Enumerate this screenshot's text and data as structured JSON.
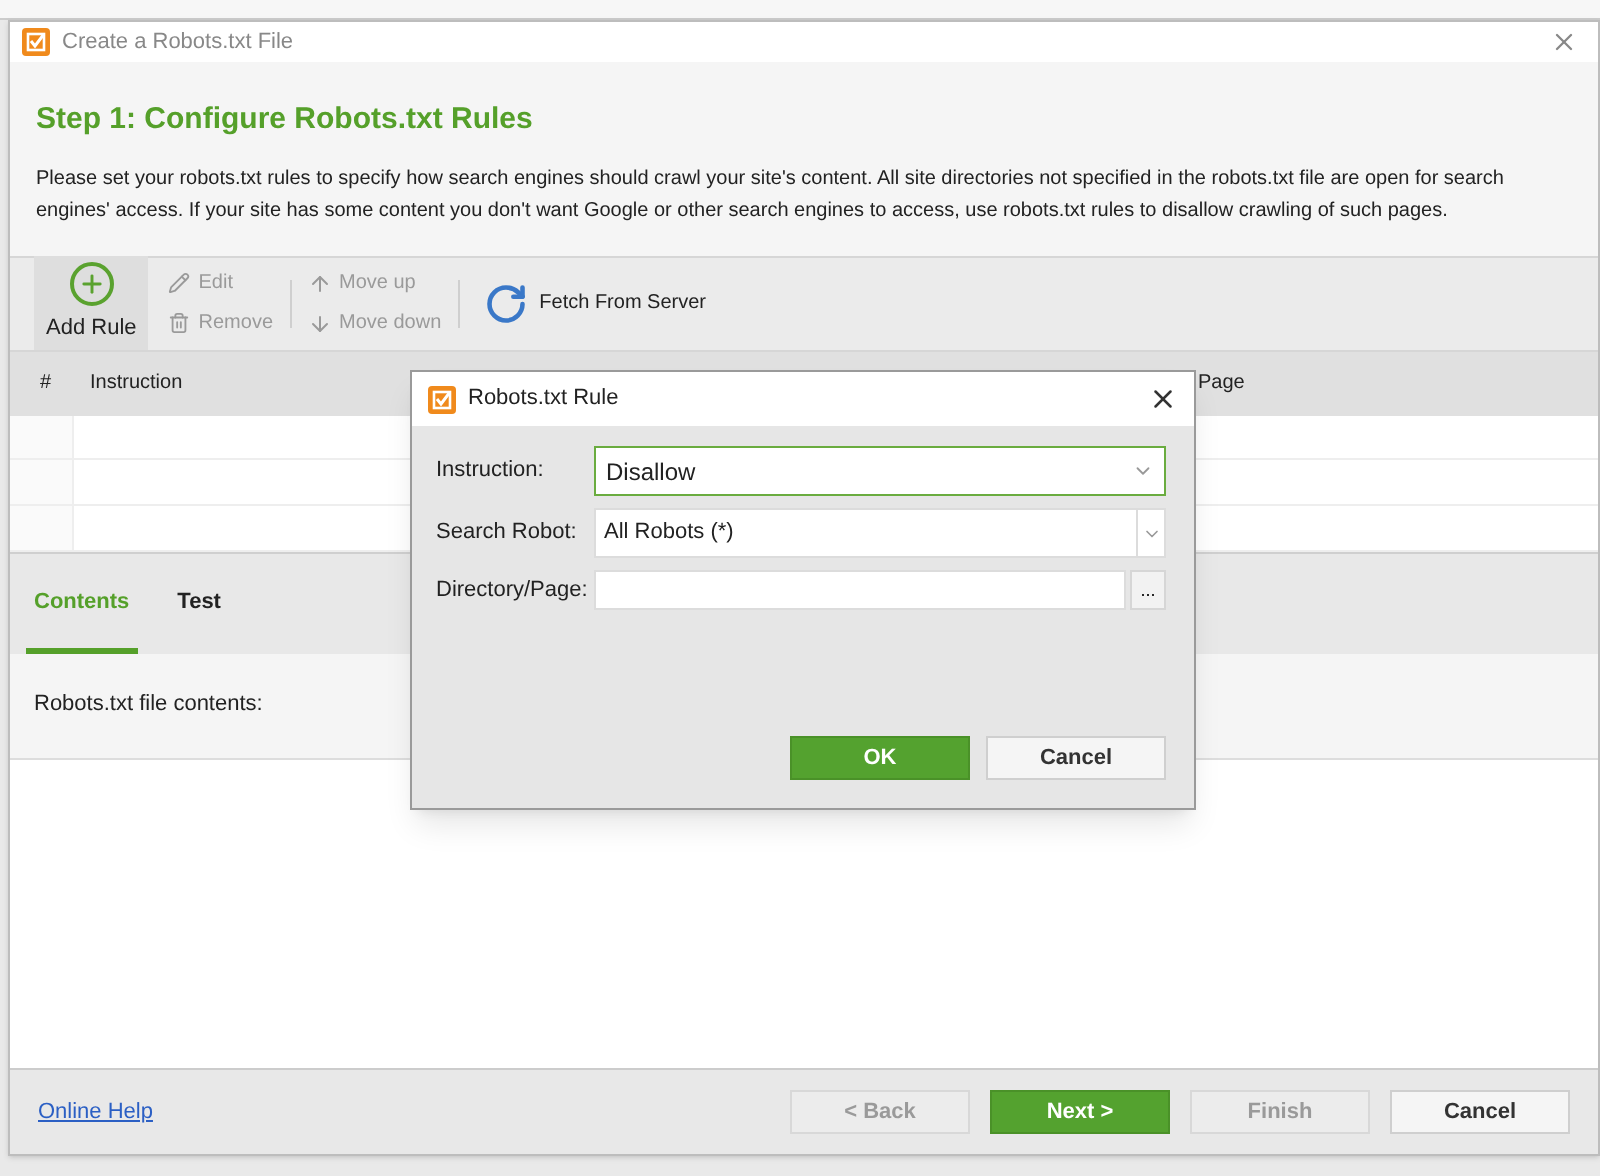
{
  "window": {
    "title": "Create a Robots.txt File"
  },
  "step_title": "Step 1: Configure Robots.txt Rules",
  "description": "Please set your robots.txt rules to specify how search engines should crawl your site's content. All site directories not specified in the robots.txt file are open for search engines' access. If your site has some content you don't want Google or other search engines to access, use robots.txt rules to disallow crawling of such pages.",
  "toolbar": [
    {
      "kind": "big",
      "label": "Add Rule",
      "disabled": false
    },
    {
      "kind": "pair",
      "items": [
        {
          "label": "Edit",
          "disabled": true
        },
        {
          "label": "Remove",
          "disabled": true
        }
      ]
    },
    {
      "kind": "pair",
      "items": [
        {
          "label": "Move up",
          "disabled": true
        },
        {
          "label": "Move down",
          "disabled": true
        }
      ]
    },
    {
      "kind": "wide",
      "label": "Fetch From Server",
      "disabled": false
    }
  ],
  "table": {
    "columns": [
      "#",
      "Instruction",
      "Page"
    ]
  },
  "tabs": [
    {
      "label": "Contents",
      "selected": true
    },
    {
      "label": "Test",
      "selected": false
    }
  ],
  "contents_label": "Robots.txt file contents:",
  "footer": {
    "link": "Online Help",
    "buttons": [
      {
        "label": "< Back",
        "kind": "normal",
        "disabled": true
      },
      {
        "label": "Next >",
        "kind": "primary",
        "disabled": false
      },
      {
        "label": "Finish",
        "kind": "normal",
        "disabled": true
      },
      {
        "label": "Cancel",
        "kind": "normal",
        "disabled": false
      }
    ]
  },
  "dialog": {
    "title": "Robots.txt Rule",
    "fields": [
      {
        "label": "Instruction:",
        "kind": "select",
        "value": "Disallow",
        "focused": true
      },
      {
        "label": "Search Robot:",
        "kind": "combo",
        "value": "All Robots (*)",
        "focused": false
      },
      {
        "label": "Directory/Page:",
        "kind": "browse",
        "button": "...",
        "focused": false
      }
    ],
    "buttons": [
      {
        "label": "OK",
        "kind": "primary"
      },
      {
        "label": "Cancel",
        "kind": "normal"
      }
    ]
  }
}
